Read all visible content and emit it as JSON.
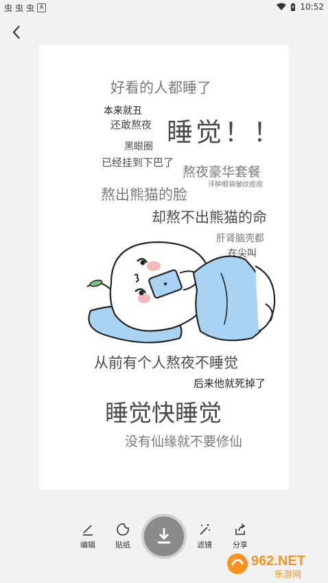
{
  "status": {
    "left_icons": [
      "虫",
      "虫",
      "虫"
    ],
    "a_icon": "A",
    "time": "10:52"
  },
  "header": {
    "back_icon": "chevron-left-icon"
  },
  "card_text": {
    "l1": "好看的人都睡了",
    "l2": "本来就丑",
    "l3": "还敢熬夜",
    "l4": "睡觉！！",
    "l5": "黑眼圈",
    "l6": "已经挂到下巴了",
    "l7": "熬夜豪华套餐",
    "l8": "浮肿眼袋皱纹痘痘",
    "l9": "熬出熊猫的脸",
    "l10": "却熬不出熊猫的命",
    "l11": "肝肾脑壳都",
    "l12": "在尖叫",
    "l13": "从前有个人熬夜不睡觉",
    "l14": "后来他就死掉了",
    "l15": "睡觉快睡觉",
    "l16": "没有仙缘就不要修仙"
  },
  "toolbar": {
    "edit": "编辑",
    "sticker": "贴纸",
    "filter": "滤镜",
    "share": "分享"
  },
  "watermark": {
    "brand": "962.NET",
    "sub": "乐游网"
  },
  "colors": {
    "blanket": "#a9d3f2",
    "blush": "#f4b8b8",
    "leaf": "#7bc47f"
  }
}
